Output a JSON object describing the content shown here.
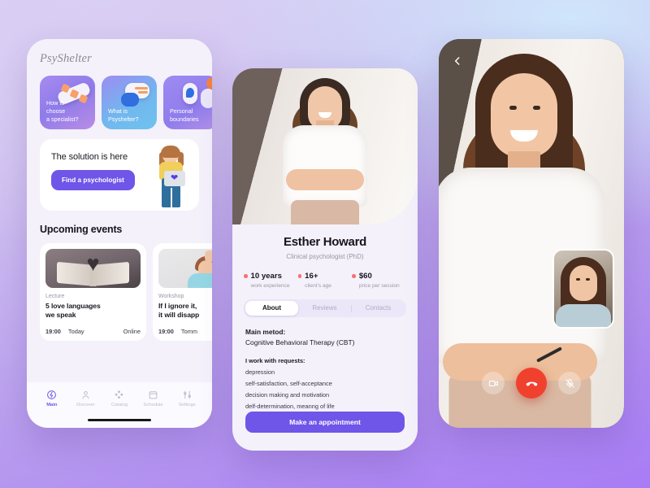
{
  "theme": {
    "accent": "#6f55e8",
    "accent_dot": "#f87171",
    "end_call": "#f0412f",
    "bg_top_left": "#d9cdf3",
    "bg_top_right": "#cfe6fb",
    "bg_bottom": "#a87cf5"
  },
  "home": {
    "logo": "PsyShelter",
    "categories": [
      {
        "label": "How to\nchoose\na specialist?",
        "icon": "pills-icon"
      },
      {
        "label": "What is\nPsyshelter?",
        "icon": "chat-bubbles-icon"
      },
      {
        "label": "Personal\nboundaries",
        "icon": "contacts-icon"
      }
    ],
    "promo": {
      "title": "The solution is here",
      "button": "Find a psychologist",
      "illustration": "girl-with-heart-icon"
    },
    "section_title": "Upcoming events",
    "events": [
      {
        "kind": "Lecture",
        "title": "5 love languages\nwe speak",
        "time": "19:00",
        "day": "Today",
        "format": "Online",
        "image": "open-book-heart-icon"
      },
      {
        "kind": "Workshop",
        "title": "If I ignore it,\nit will disapp",
        "time": "19:00",
        "day": "Tomm",
        "format": "",
        "image": "woman-facepalm-icon"
      }
    ],
    "tabs": [
      {
        "label": "Main",
        "icon": "main-icon",
        "active": true
      },
      {
        "label": "Discover",
        "icon": "person-icon",
        "active": false
      },
      {
        "label": "Catalog",
        "icon": "grid-diamond-icon",
        "active": false
      },
      {
        "label": "Schedule",
        "icon": "calendar-icon",
        "active": false
      },
      {
        "label": "Settings",
        "icon": "sliders-icon",
        "active": false
      }
    ]
  },
  "profile": {
    "photo_alt": "psychologist-portrait",
    "name": "Esther Howard",
    "role": "Clinical psychologist (PhD)",
    "stats": [
      {
        "value": "10 years",
        "label": "work experience"
      },
      {
        "value": "16+",
        "label": "client's age"
      },
      {
        "value": "$60",
        "label": "price per session"
      }
    ],
    "tabs": [
      {
        "label": "About",
        "active": true
      },
      {
        "label": "Reviews",
        "active": false
      },
      {
        "label": "Contacts",
        "active": false
      }
    ],
    "about": {
      "method_heading": "Main metod:",
      "method_value": "Cognitive Behavioral Therapy (CBT)",
      "requests_heading": "I work with requests:",
      "requests": [
        "depression",
        "self-satisfaction, self-acceptance",
        "decision making and motivation",
        "delf-determination, meanng of life"
      ]
    },
    "cta": "Make an appointment"
  },
  "call": {
    "back_icon": "chevron-left-icon",
    "remote_alt": "remote-participant-video",
    "self_alt": "self-view-video",
    "controls": [
      {
        "name": "camera",
        "icon": "video-camera-icon"
      },
      {
        "name": "end",
        "icon": "phone-hangup-icon"
      },
      {
        "name": "mic",
        "icon": "microphone-muted-icon"
      }
    ]
  }
}
